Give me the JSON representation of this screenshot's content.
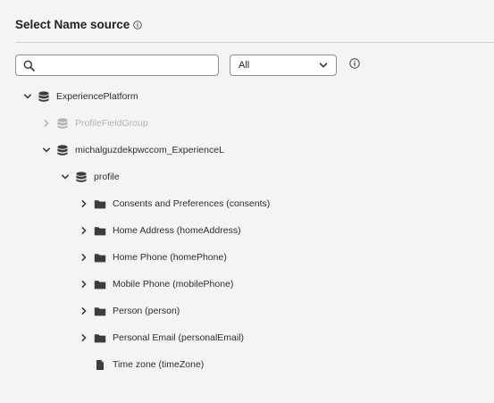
{
  "header": {
    "title": "Select Name source"
  },
  "search": {
    "value": "",
    "placeholder": ""
  },
  "filter": {
    "selected": "All"
  },
  "tree": {
    "root": "ExperiencePlatform",
    "field_group": "ProfileFieldGroup",
    "dataset": "michalguzdekpwccom_ExperienceL",
    "profile": "profile",
    "children": [
      "Consents and Preferences (consents)",
      "Home Address (homeAddress)",
      "Home Phone (homePhone)",
      "Mobile Phone (mobilePhone)",
      "Person (person)",
      "Personal Email (personalEmail)",
      "Time zone (timeZone)"
    ]
  },
  "colors": {
    "background": "#f4f4f4",
    "icon": "#3c3c3c",
    "disabled": "#b3b3b3"
  },
  "icons": [
    "info-icon",
    "search-icon",
    "chevron-down-icon",
    "chevron-right-icon",
    "database-icon",
    "folder-icon",
    "file-icon"
  ]
}
